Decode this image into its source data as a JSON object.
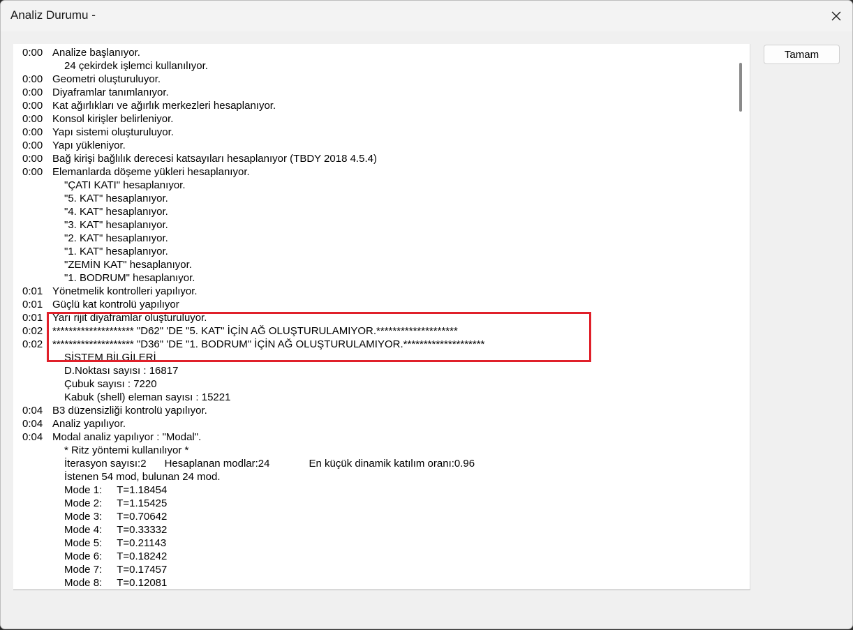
{
  "window": {
    "title": "Analiz Durumu -"
  },
  "buttons": {
    "ok_label": "Tamam"
  },
  "icons": {
    "close": "close-icon"
  },
  "highlight_color": "#e0202a",
  "log_lines": [
    {
      "time": "0:00",
      "msg": "Analize başlanıyor.",
      "indent": 0
    },
    {
      "time": "",
      "msg": "24 çekirdek işlemci kullanılıyor.",
      "indent": 1
    },
    {
      "time": "0:00",
      "msg": "Geometri oluşturuluyor.",
      "indent": 0
    },
    {
      "time": "0:00",
      "msg": "Diyaframlar tanımlanıyor.",
      "indent": 0
    },
    {
      "time": "0:00",
      "msg": "Kat ağırlıkları ve ağırlık merkezleri hesaplanıyor.",
      "indent": 0
    },
    {
      "time": "0:00",
      "msg": "Konsol kirişler belirleniyor.",
      "indent": 0
    },
    {
      "time": "0:00",
      "msg": "Yapı sistemi oluşturuluyor.",
      "indent": 0
    },
    {
      "time": "0:00",
      "msg": "Yapı yükleniyor.",
      "indent": 0
    },
    {
      "time": "0:00",
      "msg": "Bağ kirişi bağlılık derecesi katsayıları hesaplanıyor (TBDY 2018 4.5.4)",
      "indent": 0
    },
    {
      "time": "0:00",
      "msg": "Elemanlarda döşeme yükleri hesaplanıyor.",
      "indent": 0
    },
    {
      "time": "",
      "msg": "\"ÇATI KATI\" hesaplanıyor.",
      "indent": 1
    },
    {
      "time": "",
      "msg": "\"5. KAT\" hesaplanıyor.",
      "indent": 1
    },
    {
      "time": "",
      "msg": "\"4. KAT\" hesaplanıyor.",
      "indent": 1
    },
    {
      "time": "",
      "msg": "\"3. KAT\" hesaplanıyor.",
      "indent": 1
    },
    {
      "time": "",
      "msg": "\"2. KAT\" hesaplanıyor.",
      "indent": 1
    },
    {
      "time": "",
      "msg": "\"1. KAT\" hesaplanıyor.",
      "indent": 1
    },
    {
      "time": "",
      "msg": "\"ZEMİN KAT\" hesaplanıyor.",
      "indent": 1
    },
    {
      "time": "",
      "msg": "\"1. BODRUM\" hesaplanıyor.",
      "indent": 1
    },
    {
      "time": "0:01",
      "msg": "Yönetmelik kontrolleri yapılıyor.",
      "indent": 0
    },
    {
      "time": "0:01",
      "msg": "Güçlü kat kontrolü yapılıyor",
      "indent": 0
    },
    {
      "time": "0:01",
      "msg": "Yarı rijit diyaframlar oluşturuluyor.",
      "indent": 0
    },
    {
      "time": "0:02",
      "msg": "******************** \"D62\" 'DE \"5. KAT\" İÇİN AĞ OLUŞTURULAMIYOR.********************",
      "indent": 0
    },
    {
      "time": "0:02",
      "msg": "******************** \"D36\" 'DE \"1. BODRUM\" İÇİN AĞ OLUŞTURULAMIYOR.********************",
      "indent": 0
    },
    {
      "time": "",
      "msg": "SİSTEM BİLGİLERİ",
      "indent": 1
    },
    {
      "time": "",
      "msg": "D.Noktası sayısı : 16817",
      "indent": 1
    },
    {
      "time": "",
      "msg": "Çubuk sayısı : 7220",
      "indent": 1
    },
    {
      "time": "",
      "msg": "Kabuk (shell) eleman sayısı : 15221",
      "indent": 1
    },
    {
      "time": "0:04",
      "msg": "B3 düzensizliği kontrolü yapılıyor.",
      "indent": 0
    },
    {
      "time": "0:04",
      "msg": "Analiz yapılıyor.",
      "indent": 0
    },
    {
      "time": "0:04",
      "msg": "Modal analiz yapılıyor : \"Modal\".",
      "indent": 0
    },
    {
      "time": "",
      "msg": "* Ritz yöntemi kullanılıyor *",
      "indent": 1
    },
    {
      "time": "",
      "msg": "İterasyon sayısı:2",
      "indent": 1,
      "col2": "Hesaplanan modlar:24",
      "col3": "En küçük dinamik katılım oranı:0.96"
    },
    {
      "time": "",
      "msg": "İstenen 54 mod, bulunan 24 mod.",
      "indent": 1
    },
    {
      "time": "",
      "msg": "Mode 1:",
      "indent": 1,
      "col2": "T=1.18454"
    },
    {
      "time": "",
      "msg": "Mode 2:",
      "indent": 1,
      "col2": "T=1.15425"
    },
    {
      "time": "",
      "msg": "Mode 3:",
      "indent": 1,
      "col2": "T=0.70642"
    },
    {
      "time": "",
      "msg": "Mode 4:",
      "indent": 1,
      "col2": "T=0.33332"
    },
    {
      "time": "",
      "msg": "Mode 5:",
      "indent": 1,
      "col2": "T=0.21143"
    },
    {
      "time": "",
      "msg": "Mode 6:",
      "indent": 1,
      "col2": "T=0.18242"
    },
    {
      "time": "",
      "msg": "Mode 7:",
      "indent": 1,
      "col2": "T=0.17457"
    },
    {
      "time": "",
      "msg": "Mode 8:",
      "indent": 1,
      "col2": "T=0.12081"
    }
  ]
}
